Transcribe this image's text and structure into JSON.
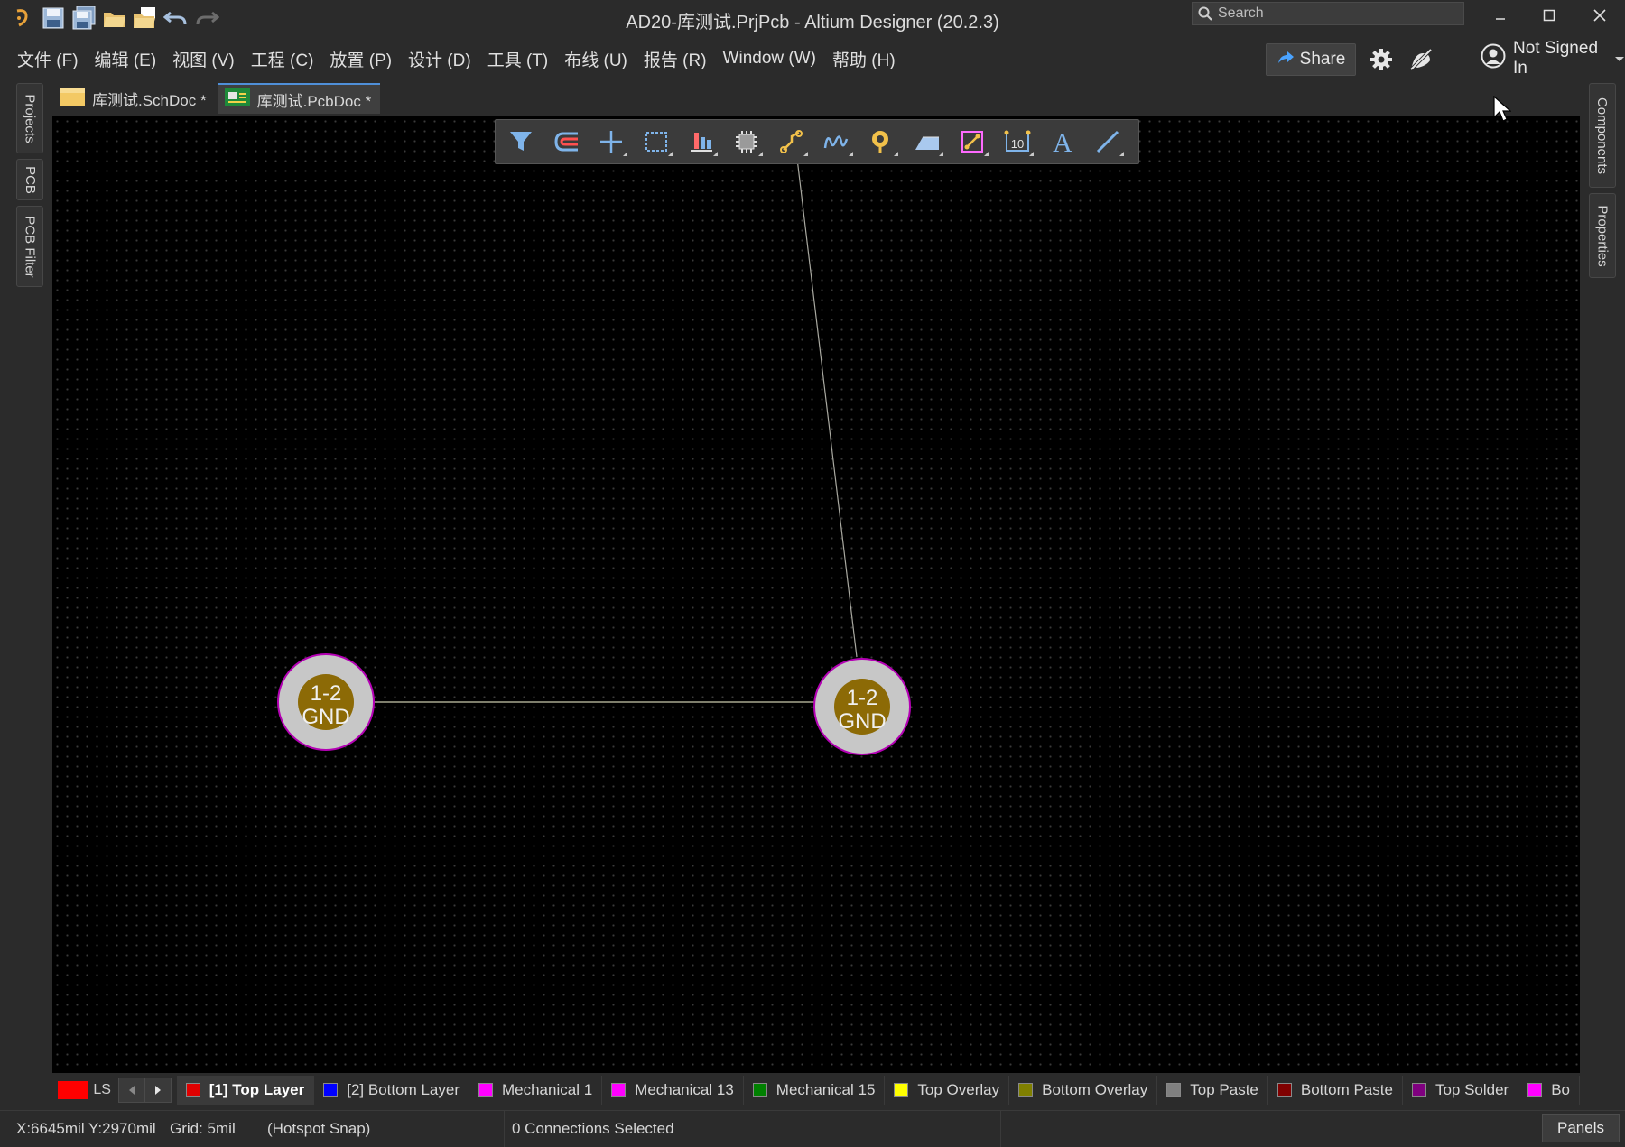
{
  "window": {
    "title": "AD20-库测试.PrjPcb - Altium Designer (20.2.3)",
    "search_placeholder": "Search"
  },
  "menu": [
    "文件 (F)",
    "编辑 (E)",
    "视图 (V)",
    "工程 (C)",
    "放置 (P)",
    "设计 (D)",
    "工具 (T)",
    "布线 (U)",
    "报告 (R)",
    "Window (W)",
    "帮助 (H)"
  ],
  "header": {
    "share_label": "Share",
    "account_label": "Not Signed In"
  },
  "left_panels": [
    "Projects",
    "PCB",
    "PCB Filter"
  ],
  "right_panels": [
    "Components",
    "Properties"
  ],
  "doc_tabs": [
    {
      "label": "库测试.SchDoc *",
      "active": false
    },
    {
      "label": "库测试.PcbDoc *",
      "active": true
    }
  ],
  "toolbar_icons": [
    "filter-icon",
    "interactive-route-icon",
    "place-origin-icon",
    "select-area-icon",
    "align-icon",
    "place-component-icon",
    "route-icon",
    "interactive-length-tune-icon",
    "place-via-icon",
    "place-fill-icon",
    "place-polygon-icon",
    "place-string-icon",
    "place-text-icon",
    "place-line-icon"
  ],
  "pads": [
    {
      "line1": "1-2",
      "line2": "GND"
    },
    {
      "line1": "1-2",
      "line2": "GND"
    }
  ],
  "layer_bar": {
    "ls_label": "LS",
    "ls_color": "#ff0000",
    "layers": [
      {
        "label": "[1] Top Layer",
        "color": "#e00000",
        "active": true
      },
      {
        "label": "[2] Bottom Layer",
        "color": "#0000ff",
        "active": false
      },
      {
        "label": "Mechanical 1",
        "color": "#ff00ff",
        "active": false
      },
      {
        "label": "Mechanical 13",
        "color": "#ff00ff",
        "active": false
      },
      {
        "label": "Mechanical 15",
        "color": "#008000",
        "active": false
      },
      {
        "label": "Top Overlay",
        "color": "#ffff00",
        "active": false
      },
      {
        "label": "Bottom Overlay",
        "color": "#808000",
        "active": false
      },
      {
        "label": "Top Paste",
        "color": "#808080",
        "active": false
      },
      {
        "label": "Bottom Paste",
        "color": "#800000",
        "active": false
      },
      {
        "label": "Top Solder",
        "color": "#800080",
        "active": false
      },
      {
        "label": "Bo",
        "color": "#ff00ff",
        "active": false
      }
    ]
  },
  "status": {
    "coords": "X:6645mil Y:2970mil",
    "grid": "Grid: 5mil",
    "snap": "(Hotspot Snap)",
    "connections": "0 Connections Selected",
    "panels_label": "Panels"
  }
}
